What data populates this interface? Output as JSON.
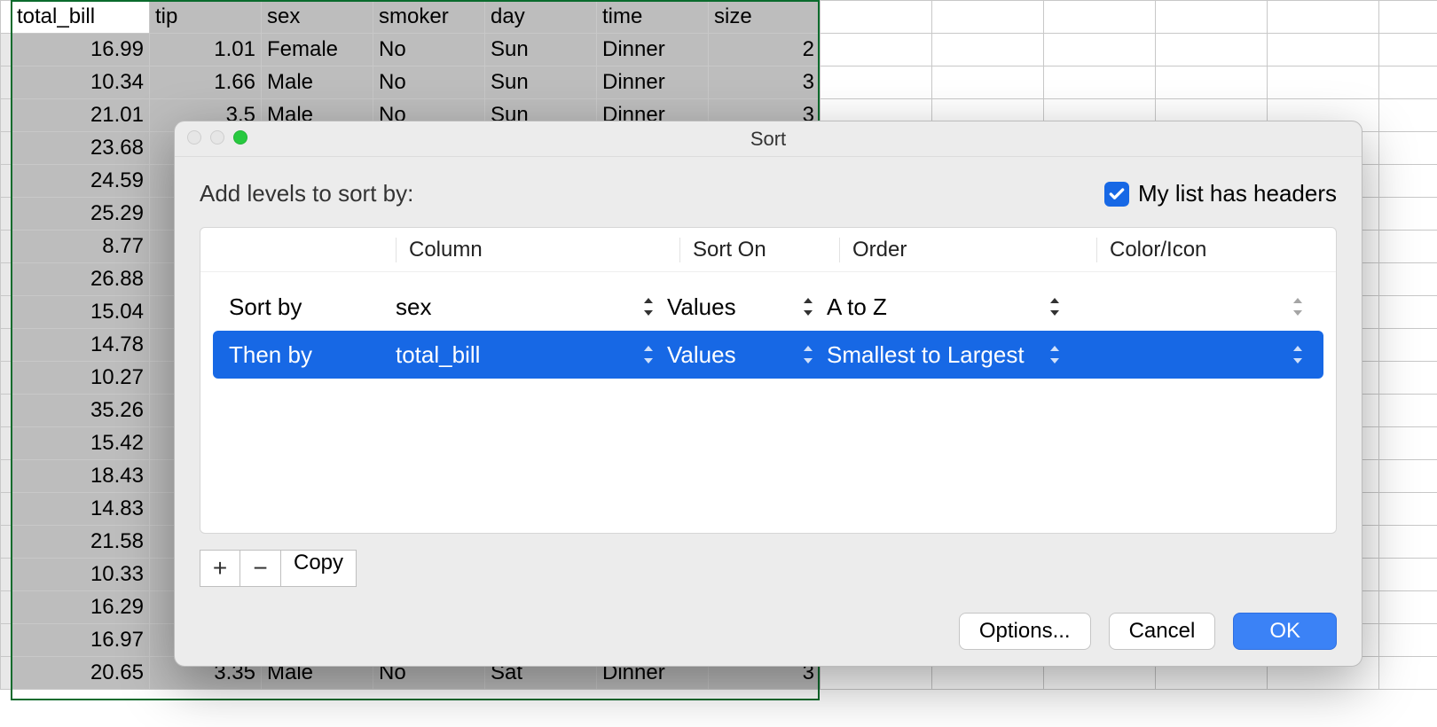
{
  "spreadsheet": {
    "headers": [
      "total_bill",
      "tip",
      "sex",
      "smoker",
      "day",
      "time",
      "size"
    ],
    "visible_rows": [
      {
        "total_bill": "16.99",
        "tip": "1.01",
        "sex": "Female",
        "smoker": "No",
        "day": "Sun",
        "time": "Dinner",
        "size": "2"
      },
      {
        "total_bill": "10.34",
        "tip": "1.66",
        "sex": "Male",
        "smoker": "No",
        "day": "Sun",
        "time": "Dinner",
        "size": "3"
      },
      {
        "total_bill": "21.01",
        "tip": "3.5",
        "sex": "Male",
        "smoker": "No",
        "day": "Sun",
        "time": "Dinner",
        "size": "3",
        "partial": true
      },
      {
        "total_bill": "23.68"
      },
      {
        "total_bill": "24.59"
      },
      {
        "total_bill": "25.29"
      },
      {
        "total_bill": "8.77"
      },
      {
        "total_bill": "26.88"
      },
      {
        "total_bill": "15.04"
      },
      {
        "total_bill": "14.78"
      },
      {
        "total_bill": "10.27"
      },
      {
        "total_bill": "35.26"
      },
      {
        "total_bill": "15.42"
      },
      {
        "total_bill": "18.43"
      },
      {
        "total_bill": "14.83"
      },
      {
        "total_bill": "21.58"
      },
      {
        "total_bill": "10.33"
      },
      {
        "total_bill": "16.29"
      },
      {
        "total_bill": "16.97"
      },
      {
        "total_bill": "20.65",
        "tip": "3.35",
        "sex": "Male",
        "smoker": "No",
        "day": "Sat",
        "time": "Dinner",
        "size": "3",
        "partial_bottom": true
      }
    ]
  },
  "dialog": {
    "title": "Sort",
    "prompt": "Add levels to sort by:",
    "headers_checkbox_label": "My list has headers",
    "columns": {
      "label": "",
      "column": "Column",
      "sorton": "Sort On",
      "order": "Order",
      "color": "Color/Icon"
    },
    "levels": [
      {
        "label": "Sort by",
        "column": "sex",
        "sorton": "Values",
        "order": "A to Z",
        "selected": false
      },
      {
        "label": "Then by",
        "column": "total_bill",
        "sorton": "Values",
        "order": "Smallest to Largest",
        "selected": true
      }
    ],
    "buttons": {
      "add": "+",
      "remove": "−",
      "copy": "Copy",
      "options": "Options...",
      "cancel": "Cancel",
      "ok": "OK"
    }
  }
}
